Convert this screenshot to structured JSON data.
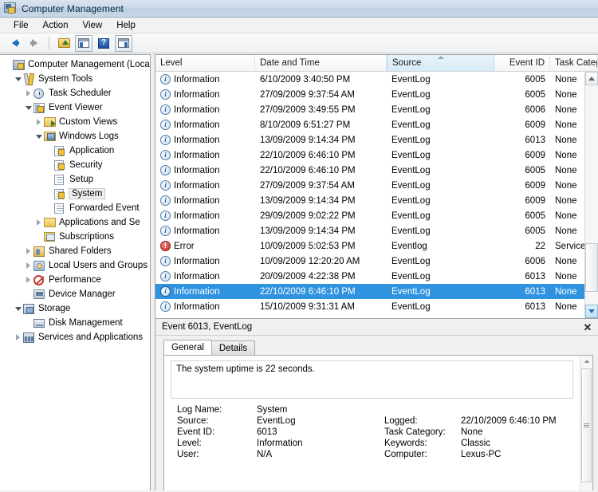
{
  "window": {
    "title": "Computer Management",
    "icon": "mmc-console-icon"
  },
  "menubar": {
    "items": [
      {
        "label": "File"
      },
      {
        "label": "Action"
      },
      {
        "label": "View"
      },
      {
        "label": "Help"
      }
    ]
  },
  "toolbar": {
    "buttons": [
      {
        "name": "back-button",
        "icon": "back-arrow-icon",
        "enabled": true
      },
      {
        "name": "forward-button",
        "icon": "forward-arrow-icon",
        "enabled": false
      },
      {
        "name": "up-one-level-button",
        "icon": "folder-up-icon",
        "enabled": true
      },
      {
        "name": "show-hide-console-tree-button",
        "icon": "left-pane-toggle-icon",
        "enabled": true
      },
      {
        "name": "help-button",
        "icon": "question-mark-icon",
        "enabled": true
      },
      {
        "name": "show-hide-action-pane-button",
        "icon": "right-pane-toggle-icon",
        "enabled": true
      }
    ]
  },
  "tree": {
    "nodes": [
      {
        "label": "Computer Management (Local",
        "indent": 0,
        "twist": "none",
        "icon": "mmc-console-icon",
        "selected": false
      },
      {
        "label": "System Tools",
        "indent": 1,
        "twist": "expanded",
        "icon": "system-tools-icon",
        "selected": false
      },
      {
        "label": "Task Scheduler",
        "indent": 2,
        "twist": "collapsed",
        "icon": "task-scheduler-clock-icon",
        "selected": false
      },
      {
        "label": "Event Viewer",
        "indent": 2,
        "twist": "expanded",
        "icon": "event-viewer-icon",
        "selected": false
      },
      {
        "label": "Custom Views",
        "indent": 3,
        "twist": "collapsed",
        "icon": "custom-views-folder-icon",
        "selected": false
      },
      {
        "label": "Windows Logs",
        "indent": 3,
        "twist": "expanded",
        "icon": "windows-logs-folder-icon",
        "selected": false
      },
      {
        "label": "Application",
        "indent": 4,
        "twist": "none",
        "icon": "application-log-icon",
        "selected": false
      },
      {
        "label": "Security",
        "indent": 4,
        "twist": "none",
        "icon": "security-log-icon",
        "selected": false
      },
      {
        "label": "Setup",
        "indent": 4,
        "twist": "none",
        "icon": "setup-log-icon",
        "selected": false
      },
      {
        "label": "System",
        "indent": 4,
        "twist": "none",
        "icon": "system-log-icon",
        "selected": true
      },
      {
        "label": "Forwarded Event",
        "indent": 4,
        "twist": "none",
        "icon": "forwarded-events-log-icon",
        "selected": false
      },
      {
        "label": "Applications and Se",
        "indent": 3,
        "twist": "collapsed",
        "icon": "applications-services-folder-icon",
        "selected": false
      },
      {
        "label": "Subscriptions",
        "indent": 3,
        "twist": "none",
        "icon": "subscriptions-icon",
        "selected": false
      },
      {
        "label": "Shared Folders",
        "indent": 2,
        "twist": "collapsed",
        "icon": "shared-folders-icon",
        "selected": false
      },
      {
        "label": "Local Users and Groups",
        "indent": 2,
        "twist": "collapsed",
        "icon": "local-users-groups-icon",
        "selected": false
      },
      {
        "label": "Performance",
        "indent": 2,
        "twist": "collapsed",
        "icon": "performance-icon",
        "selected": false
      },
      {
        "label": "Device Manager",
        "indent": 2,
        "twist": "none",
        "icon": "device-manager-icon",
        "selected": false
      },
      {
        "label": "Storage",
        "indent": 1,
        "twist": "expanded",
        "icon": "storage-icon",
        "selected": false
      },
      {
        "label": "Disk Management",
        "indent": 2,
        "twist": "none",
        "icon": "disk-management-icon",
        "selected": false
      },
      {
        "label": "Services and Applications",
        "indent": 1,
        "twist": "collapsed",
        "icon": "services-applications-icon",
        "selected": false
      }
    ]
  },
  "event_list": {
    "columns": [
      {
        "label": "Level",
        "sorted": false,
        "align": "left"
      },
      {
        "label": "Date and Time",
        "sorted": false,
        "align": "left"
      },
      {
        "label": "Source",
        "sorted": true,
        "sort_direction": "ascending",
        "align": "left"
      },
      {
        "label": "Event ID",
        "sorted": false,
        "align": "right"
      },
      {
        "label": "Task Category",
        "sorted": false,
        "align": "left"
      }
    ],
    "rows": [
      {
        "level": "Information",
        "level_icon": "information-icon",
        "datetime": "6/10/2009 3:40:50 PM",
        "source": "EventLog",
        "event_id": "6005",
        "task_category": "None",
        "selected": false
      },
      {
        "level": "Information",
        "level_icon": "information-icon",
        "datetime": "27/09/2009 9:37:54 AM",
        "source": "EventLog",
        "event_id": "6005",
        "task_category": "None",
        "selected": false
      },
      {
        "level": "Information",
        "level_icon": "information-icon",
        "datetime": "27/09/2009 3:49:55 PM",
        "source": "EventLog",
        "event_id": "6006",
        "task_category": "None",
        "selected": false
      },
      {
        "level": "Information",
        "level_icon": "information-icon",
        "datetime": "8/10/2009 6:51:27 PM",
        "source": "EventLog",
        "event_id": "6009",
        "task_category": "None",
        "selected": false
      },
      {
        "level": "Information",
        "level_icon": "information-icon",
        "datetime": "13/09/2009 9:14:34 PM",
        "source": "EventLog",
        "event_id": "6013",
        "task_category": "None",
        "selected": false
      },
      {
        "level": "Information",
        "level_icon": "information-icon",
        "datetime": "22/10/2009 6:46:10 PM",
        "source": "EventLog",
        "event_id": "6009",
        "task_category": "None",
        "selected": false
      },
      {
        "level": "Information",
        "level_icon": "information-icon",
        "datetime": "22/10/2009 6:46:10 PM",
        "source": "EventLog",
        "event_id": "6005",
        "task_category": "None",
        "selected": false
      },
      {
        "level": "Information",
        "level_icon": "information-icon",
        "datetime": "27/09/2009 9:37:54 AM",
        "source": "EventLog",
        "event_id": "6009",
        "task_category": "None",
        "selected": false
      },
      {
        "level": "Information",
        "level_icon": "information-icon",
        "datetime": "13/09/2009 9:14:34 PM",
        "source": "EventLog",
        "event_id": "6009",
        "task_category": "None",
        "selected": false
      },
      {
        "level": "Information",
        "level_icon": "information-icon",
        "datetime": "29/09/2009 9:02:22 PM",
        "source": "EventLog",
        "event_id": "6005",
        "task_category": "None",
        "selected": false
      },
      {
        "level": "Information",
        "level_icon": "information-icon",
        "datetime": "13/09/2009 9:14:34 PM",
        "source": "EventLog",
        "event_id": "6005",
        "task_category": "None",
        "selected": false
      },
      {
        "level": "Error",
        "level_icon": "error-icon",
        "datetime": "10/09/2009 5:02:53 PM",
        "source": "Eventlog",
        "event_id": "22",
        "task_category": "Service startup",
        "selected": false
      },
      {
        "level": "Information",
        "level_icon": "information-icon",
        "datetime": "10/09/2009 12:20:20 AM",
        "source": "EventLog",
        "event_id": "6006",
        "task_category": "None",
        "selected": false
      },
      {
        "level": "Information",
        "level_icon": "information-icon",
        "datetime": "20/09/2009 4:22:38 PM",
        "source": "EventLog",
        "event_id": "6013",
        "task_category": "None",
        "selected": false
      },
      {
        "level": "Information",
        "level_icon": "information-icon",
        "datetime": "22/10/2009 6:46:10 PM",
        "source": "EventLog",
        "event_id": "6013",
        "task_category": "None",
        "selected": true
      },
      {
        "level": "Information",
        "level_icon": "information-icon",
        "datetime": "15/10/2009 9:31:31 AM",
        "source": "EventLog",
        "event_id": "6013",
        "task_category": "None",
        "selected": false
      }
    ]
  },
  "detail": {
    "header_title": "Event 6013, EventLog",
    "close_label": "✕",
    "tabs": [
      {
        "label": "General",
        "active": true
      },
      {
        "label": "Details",
        "active": false
      }
    ],
    "message": "The system uptime is 22 seconds.",
    "fields": [
      {
        "k1": "Log Name:",
        "v1": "System",
        "k2": "",
        "v2": ""
      },
      {
        "k1": "Source:",
        "v1": "EventLog",
        "k2": "Logged:",
        "v2": "22/10/2009 6:46:10 PM"
      },
      {
        "k1": "Event ID:",
        "v1": "6013",
        "k2": "Task Category:",
        "v2": "None"
      },
      {
        "k1": "Level:",
        "v1": "Information",
        "k2": "Keywords:",
        "v2": "Classic"
      },
      {
        "k1": "User:",
        "v1": "N/A",
        "k2": "Computer:",
        "v2": "Lexus-PC"
      }
    ]
  },
  "colors": {
    "selection_blue": "#2f93e0",
    "title_bar": "#c9d8e8",
    "error_red": "#c32b22",
    "info_blue": "#2a5f96",
    "sorted_header": "#d6eaf8"
  }
}
